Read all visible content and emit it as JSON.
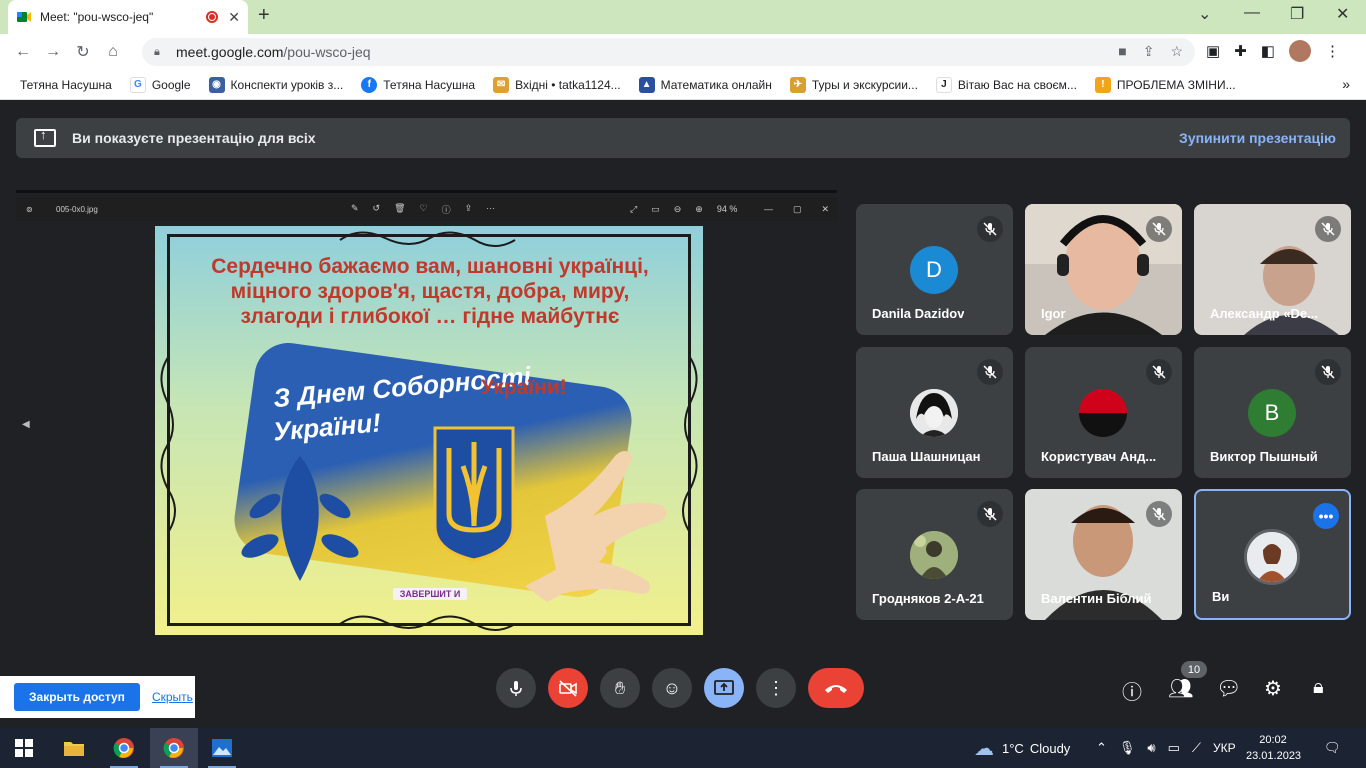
{
  "browser": {
    "tab_title": "Meet: \"pou-wsco-jeq\"",
    "url_host": "meet.google.com",
    "url_path": "/pou-wsco-jeq"
  },
  "bookmarks": [
    {
      "label": "Тетяна Насушна",
      "color": "#ffffff"
    },
    {
      "label": "Google",
      "color": "#4285f4"
    },
    {
      "label": "Конспекти уроків з...",
      "color": "#3b5fa0"
    },
    {
      "label": "Тетяна Насушна",
      "color": "#1877f2"
    },
    {
      "label": "Вхідні • tatka1124...",
      "color": "#e0a030"
    },
    {
      "label": "Математика онлайн",
      "color": "#2a4f9c"
    },
    {
      "label": "Туры и экскурсии...",
      "color": "#d8a030"
    },
    {
      "label": "Вітаю Вас на своєм...",
      "color": "#222222"
    },
    {
      "label": "ПРОБЛЕМА ЗМІНИ...",
      "color": "#f2a51a"
    }
  ],
  "banner": {
    "text": "Ви показуєте презентацію для всіх",
    "stop_label": "Зупинити презентацію"
  },
  "viewer": {
    "file_name": "005-0x0.jpg",
    "zoom": "94 %"
  },
  "slide": {
    "greeting": "Сердечно бажаємо вам, шановні українці, міцного здоров'я, щастя, добра, миру, злагоди і глибокої … гідне майбутнє",
    "title_line1": "З Днем Соборності",
    "title_line2": "України!",
    "title_overlay": "України!",
    "end_button": "ЗАВЕРШИТ И"
  },
  "participants": [
    {
      "name": "Danila Dazidov",
      "initial": "D",
      "color": "#1a8ad4",
      "muted": true
    },
    {
      "name": "Igor",
      "muted": true
    },
    {
      "name": "Александр «De...",
      "muted": true
    },
    {
      "name": "Паша Шашницан",
      "muted": true
    },
    {
      "name": "Користувач Анд...",
      "muted": true
    },
    {
      "name": "Виктор Пышный",
      "initial": "B",
      "color": "#2e7d32",
      "muted": true
    },
    {
      "name": "Гродняков 2-А-21",
      "muted": true
    },
    {
      "name": "Валентин Біблий",
      "muted": true
    },
    {
      "name": "Ви",
      "muted": false
    }
  ],
  "controls": {
    "participants_count": "10"
  },
  "popup": {
    "close_access": "Закрыть доступ",
    "hide": "Скрыть"
  },
  "taskbar": {
    "temperature": "1°C",
    "weather": "Cloudy",
    "language": "УКР",
    "time": "20:02",
    "date": "23.01.2023"
  }
}
